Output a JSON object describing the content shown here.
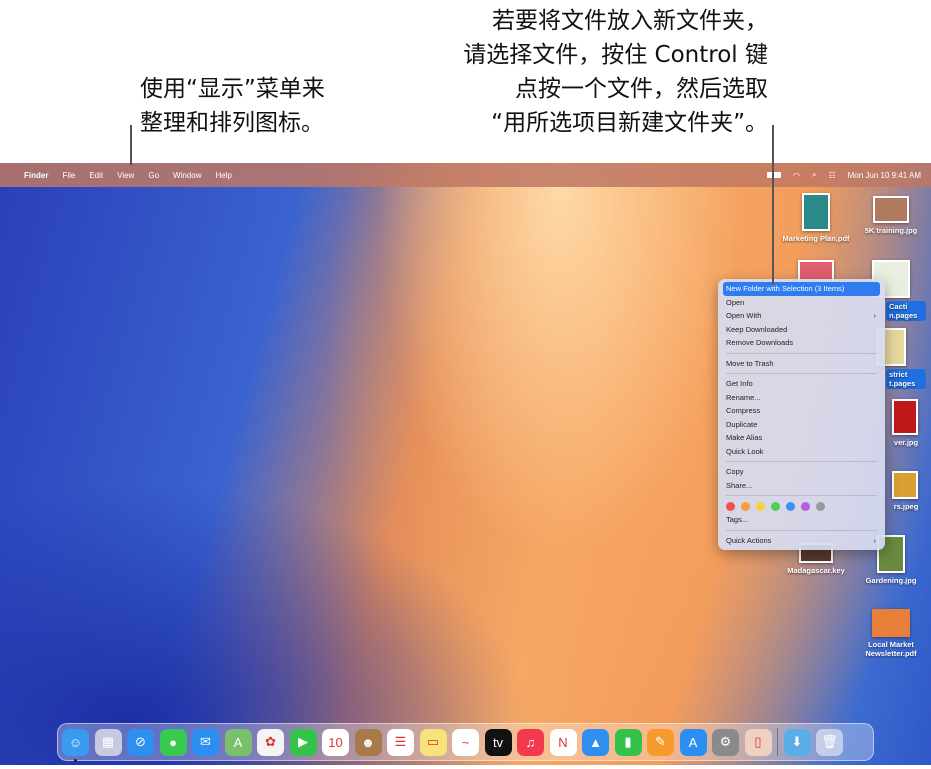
{
  "callouts": {
    "left": [
      "使用“显示”菜单来",
      "整理和排列图标。"
    ],
    "right": [
      "若要将文件放入新文件夹，",
      "请选择文件，按住 Control 键",
      "点按一个文件，然后选取",
      "“用所选项目新建文件夹”。"
    ]
  },
  "menubar": {
    "apple": "",
    "app": "Finder",
    "items": [
      "File",
      "Edit",
      "View",
      "Go",
      "Window",
      "Help"
    ],
    "clock": "Mon Jun 10  9:41 AM"
  },
  "desktop": {
    "icons": [
      "Marketing Plan.pdf",
      "5K training.jpg",
      "Cacti\nn.pages",
      "strict\nt.pages",
      "ver.jpg",
      "rs.jpeg",
      "Madagascar.key",
      "Gardening.jpg",
      "Local Market Newsletter.pdf"
    ]
  },
  "context_menu": {
    "items": [
      "New Folder with Selection (3 Items)",
      "Open",
      "Open With",
      "Keep Downloaded",
      "Remove Downloads",
      "Move to Trash",
      "Get Info",
      "Rename...",
      "Compress",
      "Duplicate",
      "Make Alias",
      "Quick Look",
      "Copy",
      "Share...",
      "Tags...",
      "Quick Actions"
    ],
    "chevron": "›",
    "tag_colors": [
      "#f0524f",
      "#f59e3b",
      "#f7d03c",
      "#4fcc5a",
      "#3f8ef5",
      "#b45ee0",
      "#9a9a9a"
    ]
  },
  "dock": {
    "apps": [
      {
        "name": "finder",
        "g": "☺",
        "c": "#3a9af0"
      },
      {
        "name": "launchpad",
        "g": "▦",
        "c": "#c8c8e0"
      },
      {
        "name": "safari",
        "g": "⊘",
        "c": "#2f8ff0"
      },
      {
        "name": "messages",
        "g": "●",
        "c": "#39c950"
      },
      {
        "name": "mail",
        "g": "✉",
        "c": "#2a8ef2"
      },
      {
        "name": "maps",
        "g": "A",
        "c": "#7ac06a"
      },
      {
        "name": "photos",
        "g": "✿",
        "c": "#f4f4f4"
      },
      {
        "name": "facetime",
        "g": "▶",
        "c": "#35c24a"
      },
      {
        "name": "calendar",
        "g": "10",
        "c": "#ffffff"
      },
      {
        "name": "contacts",
        "g": "☻",
        "c": "#a87a4a"
      },
      {
        "name": "reminders",
        "g": "☰",
        "c": "#ffffff"
      },
      {
        "name": "notes",
        "g": "▭",
        "c": "#f8e27a"
      },
      {
        "name": "freeform",
        "g": "~",
        "c": "#ffffff"
      },
      {
        "name": "tv",
        "g": "tv",
        "c": "#111111"
      },
      {
        "name": "music",
        "g": "♫",
        "c": "#f23a4f"
      },
      {
        "name": "news",
        "g": "N",
        "c": "#ffffff"
      },
      {
        "name": "keynote",
        "g": "▲",
        "c": "#2f8ff0"
      },
      {
        "name": "numbers",
        "g": "▮",
        "c": "#35c24a"
      },
      {
        "name": "pages",
        "g": "✎",
        "c": "#f59a2b"
      },
      {
        "name": "app-store",
        "g": "A",
        "c": "#2a8ef2"
      },
      {
        "name": "system-settings",
        "g": "⚙",
        "c": "#8a8a8a"
      },
      {
        "name": "iphone-mirroring",
        "g": "▯",
        "c": "#f0d0c0"
      }
    ],
    "downloads": "⬇",
    "trash": "🗑"
  }
}
